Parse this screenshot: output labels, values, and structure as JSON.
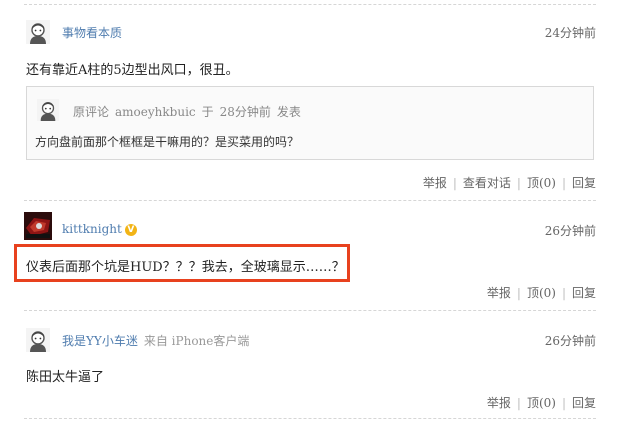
{
  "comments": [
    {
      "username": "事物看本质",
      "time": "24分钟前",
      "text": "还有靠近A柱的5边型出风口，很丑。",
      "quote": {
        "label": "原评论",
        "user": "amoeyhkbuic",
        "at": "于",
        "time": "28分钟前",
        "posted": "发表",
        "text": "方向盘前面那个框框是干嘛用的？是买菜用的吗？"
      },
      "actions": {
        "report": "举报",
        "view_conversation": "查看对话",
        "upvote": "顶(0)",
        "reply": "回复"
      }
    },
    {
      "username": "kittknight",
      "badge": "V",
      "time": "26分钟前",
      "text": "仪表后面那个坑是HUD？？？我去，全玻璃显示……？",
      "actions": {
        "report": "举报",
        "upvote": "顶(0)",
        "reply": "回复"
      }
    },
    {
      "username": "我是YY小车迷",
      "source": "来自 iPhone客户端",
      "time": "26分钟前",
      "text": "陈田太牛逼了",
      "actions": {
        "report": "举报",
        "upvote": "顶(0)",
        "reply": "回复"
      }
    }
  ],
  "colors": {
    "username": "#507daf",
    "highlight": "#e8411e",
    "badge": "#f2b416"
  },
  "icons": {
    "avatar": "default-avatar-icon",
    "verified": "verified-badge-icon"
  }
}
